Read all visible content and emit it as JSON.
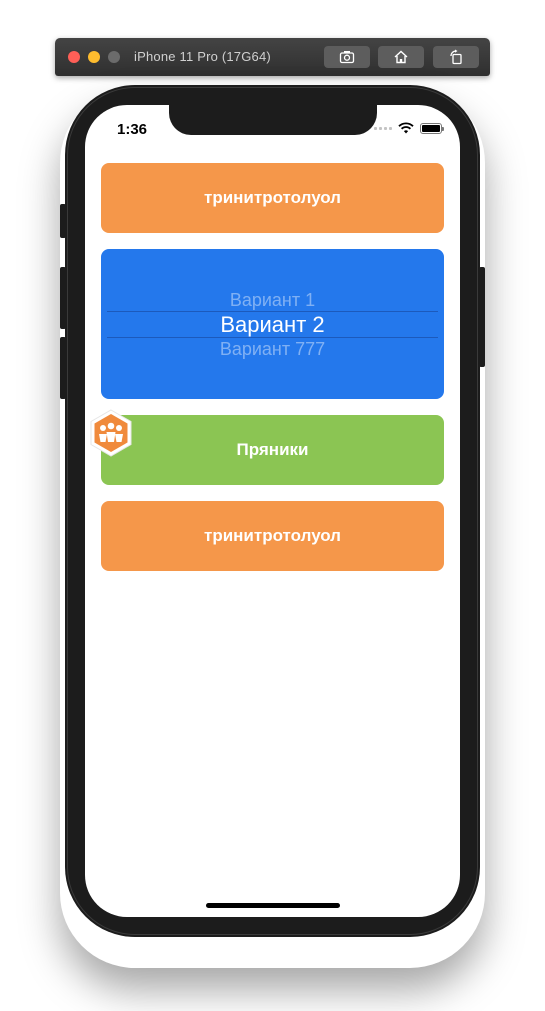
{
  "simulator": {
    "title": "iPhone 11 Pro (17G64)",
    "toolbar_icons": [
      "screenshot-icon",
      "home-icon",
      "rotate-icon"
    ]
  },
  "status_bar": {
    "time": "1:36"
  },
  "buttons": {
    "top": {
      "label": "тринитротолуол",
      "color": "#f5974a"
    },
    "middle": {
      "label": "Пряники",
      "color": "#8bc553"
    },
    "bottom": {
      "label": "тринитротолуол",
      "color": "#f5974a"
    }
  },
  "picker": {
    "color": "#2478ec",
    "options": [
      "Вариант 1",
      "Вариант 2",
      "Вариант 777"
    ],
    "selected": "Вариант 2"
  },
  "floating_badge": {
    "icon": "people-group-icon",
    "color": "#f08a3c"
  }
}
